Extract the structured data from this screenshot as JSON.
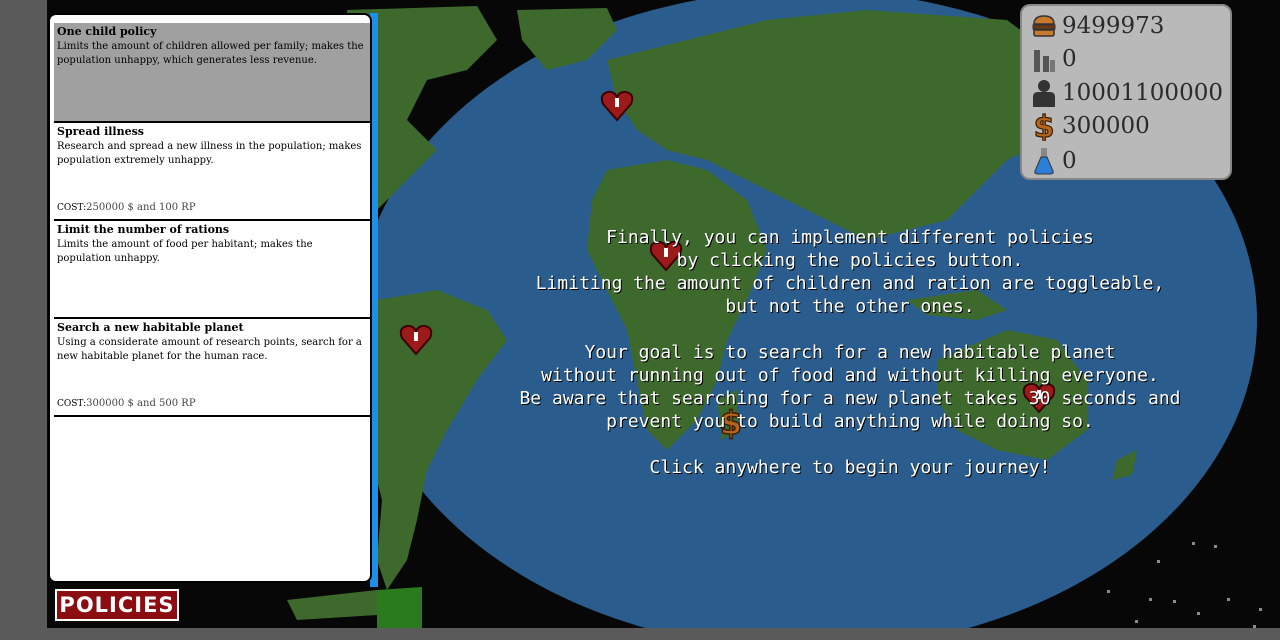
{
  "policies": {
    "items": [
      {
        "title": "One child policy",
        "description": "Limits the amount of children allowed per family; makes the population unhappy, which generates less revenue.",
        "cost_label": "",
        "cost": "",
        "selected": true
      },
      {
        "title": "Spread illness",
        "description": "Research and spread a new illness in the population; makes population extremely unhappy.",
        "cost_label": "COST:",
        "cost": "250000 $ and 100 RP",
        "selected": false
      },
      {
        "title": "Limit the number of rations",
        "description": "Limits the amount of food per habitant; makes the population unhappy.",
        "cost_label": "",
        "cost": "",
        "selected": false
      },
      {
        "title": "Search a new habitable planet",
        "description": "Using a considerate amount of research points, search for a new habitable planet for the human race.",
        "cost_label": "COST:",
        "cost": "300000 $ and 500 RP",
        "selected": false
      }
    ],
    "button_label": "POLICIES"
  },
  "stats": {
    "food": "9499973",
    "factories": "0",
    "population": "10001100000",
    "money": "300000",
    "research": "0"
  },
  "tutorial": {
    "text": "Finally, you can implement different policies\nby clicking the policies button.\nLimiting the amount of children and ration are toggleable,\nbut not the other ones.\n\nYour goal is to search for a new habitable planet\nwithout running out of food and without killing everyone.\nBe aware that searching for a new planet takes 30 seconds and\nprevent you to build anything while doing so.\n\nClick anywhere to begin your journey!"
  },
  "icons": {
    "food": "burger-icon",
    "factories": "factory-icon",
    "population": "person-icon",
    "money": "dollar-icon",
    "research": "flask-icon",
    "markers": [
      "heart-marker-icon",
      "heart-marker-icon",
      "heart-marker-icon",
      "heart-marker-icon",
      "dollar-marker-icon"
    ]
  },
  "colors": {
    "ocean": "#2a5d8d",
    "land": "#3d6a2c",
    "button": "#8b0d12",
    "panel_accent": "#1e8fe8"
  }
}
